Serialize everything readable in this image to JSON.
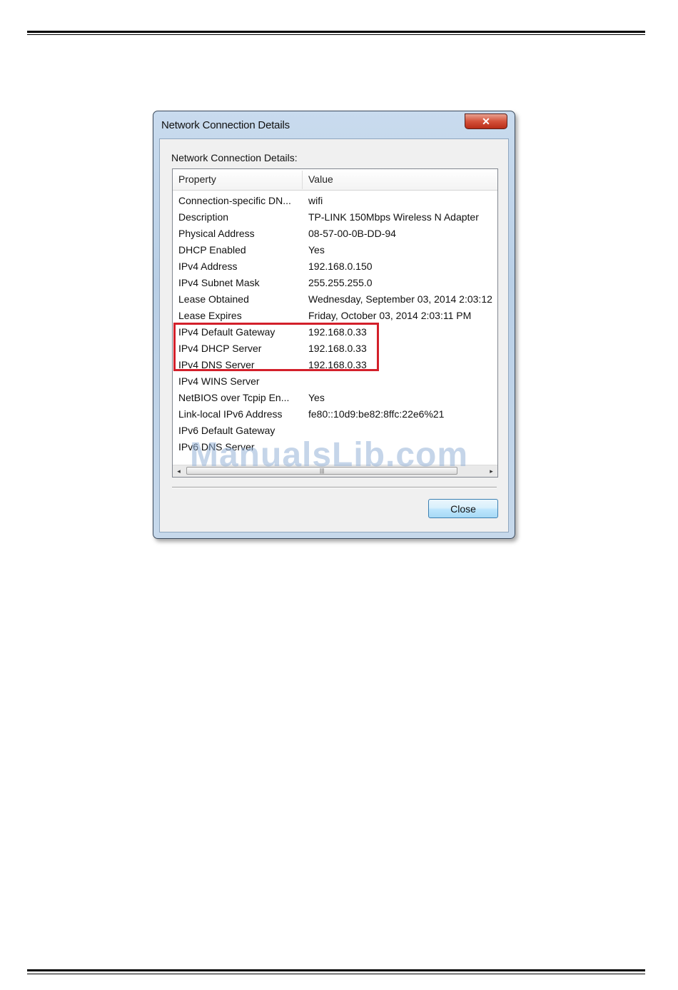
{
  "window": {
    "title": "Network Connection Details",
    "close_glyph": "✕",
    "group_label": "Network Connection Details:",
    "columns": {
      "property": "Property",
      "value": "Value"
    },
    "rows": [
      {
        "property": "Connection-specific DN...",
        "value": "wifi"
      },
      {
        "property": "Description",
        "value": "TP-LINK 150Mbps Wireless N Adapter"
      },
      {
        "property": "Physical Address",
        "value": "08-57-00-0B-DD-94"
      },
      {
        "property": "DHCP Enabled",
        "value": "Yes"
      },
      {
        "property": "IPv4 Address",
        "value": "192.168.0.150"
      },
      {
        "property": "IPv4 Subnet Mask",
        "value": "255.255.255.0"
      },
      {
        "property": "Lease Obtained",
        "value": "Wednesday, September 03, 2014 2:03:12"
      },
      {
        "property": "Lease Expires",
        "value": "Friday, October 03, 2014 2:03:11 PM"
      },
      {
        "property": "IPv4 Default Gateway",
        "value": "192.168.0.33"
      },
      {
        "property": "IPv4 DHCP Server",
        "value": "192.168.0.33"
      },
      {
        "property": "IPv4 DNS Server",
        "value": "192.168.0.33"
      },
      {
        "property": "IPv4 WINS Server",
        "value": ""
      },
      {
        "property": "NetBIOS over Tcpip En...",
        "value": "Yes"
      },
      {
        "property": "Link-local IPv6 Address",
        "value": "fe80::10d9:be82:8ffc:22e6%21"
      },
      {
        "property": "IPv6 Default Gateway",
        "value": ""
      },
      {
        "property": "IPv6 DNS Server",
        "value": ""
      }
    ],
    "scroll": {
      "left": "◂",
      "right": "▸",
      "grip": "|||"
    },
    "close_button": "Close"
  },
  "watermark": "ManualsLib.com",
  "colors": {
    "highlight_box": "#d31f2a",
    "titlebar": "#c9dbee"
  }
}
